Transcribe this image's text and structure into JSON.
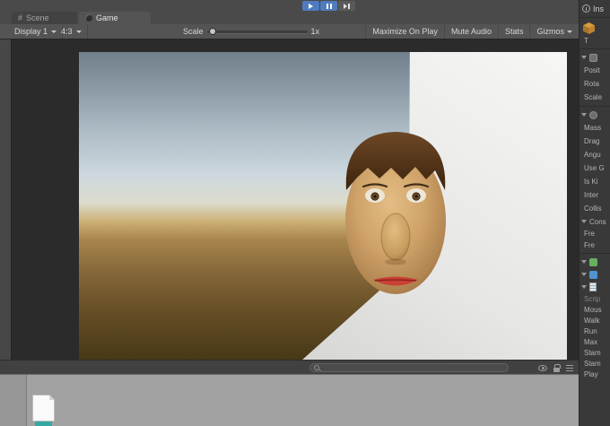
{
  "colors": {
    "accent_blue": "#4f7cbf",
    "toolbar_gray": "#545454",
    "inspector_bg": "#393939",
    "skin": "#c9a066",
    "hair": "#4a2f15",
    "lips": "#c94034",
    "wall_white": "#ededeb",
    "asset_teal": "#35a8a4"
  },
  "icons": {
    "transport": [
      "play-icon",
      "pause-icon",
      "step-icon"
    ],
    "tabs": [
      "scene-grid-icon",
      "game-tab-icon"
    ],
    "status_bar": [
      "search-icon",
      "eye-icon",
      "lock-icon",
      "menu-icon"
    ],
    "project": [
      "document-icon"
    ],
    "inspector": [
      "inspector-icon",
      "cube-icon",
      "transform-icon",
      "rigidbody-icon",
      "collider-icon",
      "component-icon",
      "script-icon"
    ]
  },
  "tabs": {
    "scene": {
      "label": "Scene",
      "icon_glyph": "#",
      "active": false
    },
    "game": {
      "label": "Game",
      "active": true
    }
  },
  "game_toolbar": {
    "display": "Display 1",
    "aspect": "4:3",
    "scale_label": "Scale",
    "scale_value": "1x",
    "maximize": "Maximize On Play",
    "mute": "Mute Audio",
    "stats": "Stats",
    "gizmos": "Gizmos"
  },
  "inspector": {
    "title": "Ins",
    "tag_row": "T",
    "transform_fields": [
      "Posit",
      "Rota",
      "Scale"
    ],
    "rigidbody_fields": [
      "Mass",
      "Drag",
      "Angu",
      "Use G",
      "Is Ki",
      "Inter",
      "Collis"
    ],
    "constraints": {
      "label": "Cons",
      "fields": [
        "Fre",
        "Fre"
      ]
    },
    "script": {
      "script_field": "Scrip",
      "fields": [
        "Mous",
        "Walk",
        "Run",
        "Max",
        "Stam",
        "Stam",
        "Play"
      ]
    }
  }
}
